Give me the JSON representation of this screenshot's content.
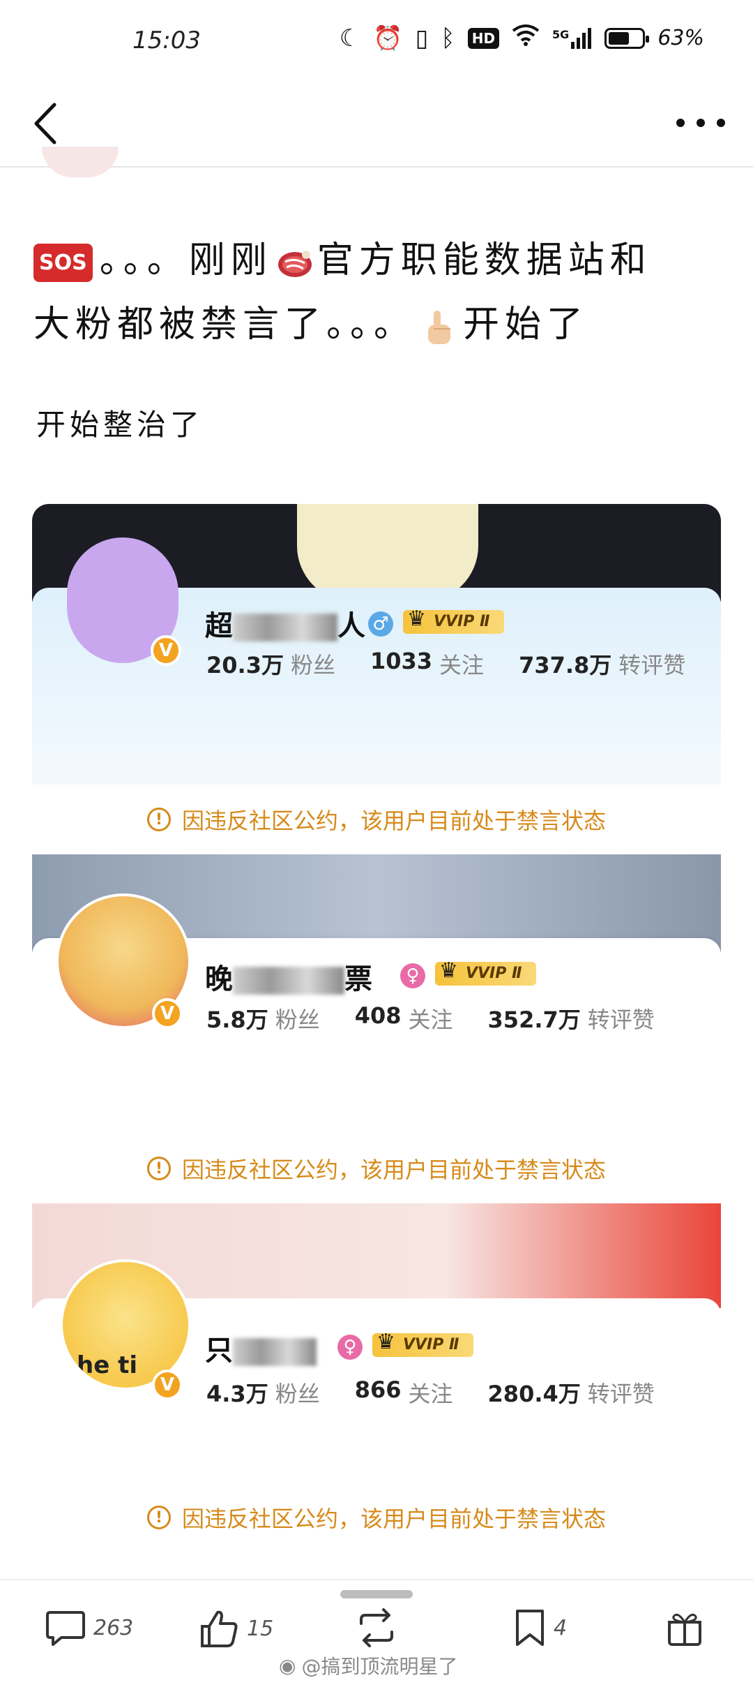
{
  "status_bar": {
    "time": "15:03",
    "network": "5G",
    "hd": "HD",
    "battery_percent": "63%",
    "battery_level": 0.63
  },
  "nav": {
    "back_icon": "chevron-left-icon",
    "more_icon": "more-dots-icon"
  },
  "post": {
    "line1_sos": "SOS",
    "line1_dots": "。。。",
    "line1_a": "刚刚",
    "line1_b": "官方职能数据站和",
    "line2_a": "大粉都被禁言了。。。",
    "line2_b": "开始了",
    "subtext": "开始整治了"
  },
  "cards": [
    {
      "name_prefix": "超",
      "name_suffix": "人",
      "vvip_label": "VVIP Ⅱ",
      "gender": "♂",
      "followers_num": "20.3万",
      "followers_label": "粉丝",
      "following_num": "1033",
      "following_label": "关注",
      "engagement_num": "737.8万",
      "engagement_label": "转评赞",
      "warning": "因违反社区公约，该用户目前处于禁言状态",
      "colors": {
        "banner": "#1c1c24",
        "panel": "#dff0fb",
        "avatar": "#c9a7ee",
        "gender": "#5aa8e6"
      }
    },
    {
      "name_prefix": "晚",
      "name_suffix": "票",
      "vvip_label": "VVIP Ⅱ",
      "gender": "♀",
      "followers_num": "5.8万",
      "followers_label": "粉丝",
      "following_num": "408",
      "following_label": "关注",
      "engagement_num": "352.7万",
      "engagement_label": "转评赞",
      "warning": "因违反社区公约，该用户目前处于禁言状态",
      "colors": {
        "banner": "#8e9cb0",
        "panel": "#ffffff",
        "avatar": "#f0b85a",
        "gender": "#e86aa6"
      }
    },
    {
      "name_prefix": "只",
      "name_suffix": "",
      "vvip_label": "VVIP Ⅱ",
      "gender": "♀",
      "followers_num": "4.3万",
      "followers_label": "粉丝",
      "following_num": "866",
      "following_label": "关注",
      "engagement_num": "280.4万",
      "engagement_label": "转评赞",
      "warning": "因违反社区公约，该用户目前处于禁言状态",
      "colors": {
        "banner": "#f3d9d6",
        "panel": "#ffffff",
        "avatar": "#f7c94d",
        "gender": "#e86aa6"
      },
      "avatar_text": "he ti"
    }
  ],
  "bottom_bar": {
    "comments": "263",
    "likes": "15",
    "favorites": "4"
  },
  "watermark": "@搞到顶流明星了"
}
